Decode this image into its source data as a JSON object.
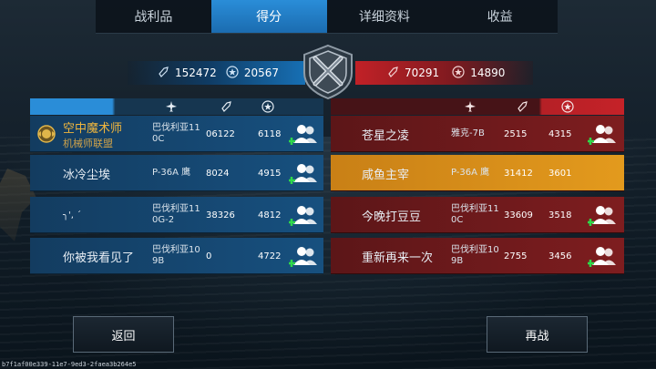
{
  "tabs": [
    {
      "label": "战利品",
      "active": false
    },
    {
      "label": "得分",
      "active": true
    },
    {
      "label": "详细资料",
      "active": false
    },
    {
      "label": "收益",
      "active": false
    }
  ],
  "score_header": {
    "left_kills": "152472",
    "left_score": "20567",
    "right_kills": "70291",
    "right_score": "14890"
  },
  "left_team": [
    {
      "name": "空中魔术师",
      "guild": "机械师联盟",
      "plane": "巴伐利亚11 0C",
      "kills": "06122",
      "score": "6118",
      "has_badge": true
    },
    {
      "name": "冰冷尘埃",
      "guild": "",
      "plane": "P-36A 鹰",
      "kills": "8024",
      "score": "4915",
      "has_badge": false
    },
    {
      "name": "╮', ´",
      "guild": "",
      "plane": "巴伐利亚11 0G-2",
      "kills": "38326",
      "score": "4812",
      "has_badge": false
    },
    {
      "name": "你被我看见了",
      "guild": "",
      "plane": "巴伐利亚10 9B",
      "kills": "0",
      "score": "4722",
      "has_badge": false
    }
  ],
  "right_team": [
    {
      "name": "苍星之凌",
      "plane": "雅克-7B",
      "kills": "2515",
      "score": "4315",
      "highlight": false
    },
    {
      "name": "咸鱼主宰",
      "plane": "P-36A 鹰",
      "kills": "31412",
      "score": "3601",
      "highlight": true
    },
    {
      "name": "今晚打豆豆",
      "plane": "巴伐利亚11 0C",
      "kills": "33609",
      "score": "3518",
      "highlight": false
    },
    {
      "name": "重新再来一次",
      "plane": "巴伐利亚10 9B",
      "kills": "2755",
      "score": "3456",
      "highlight": false
    }
  ],
  "buttons": {
    "back": "返回",
    "rematch": "再战"
  },
  "footer_id": "b7f1af00e339-11e7-9ed3-2faea3b264e5",
  "colors": {
    "blue_team": "#17507f",
    "red_team": "#7e1d1f",
    "highlight": "#e39a1d",
    "tab_active": "#2a8dd8"
  }
}
